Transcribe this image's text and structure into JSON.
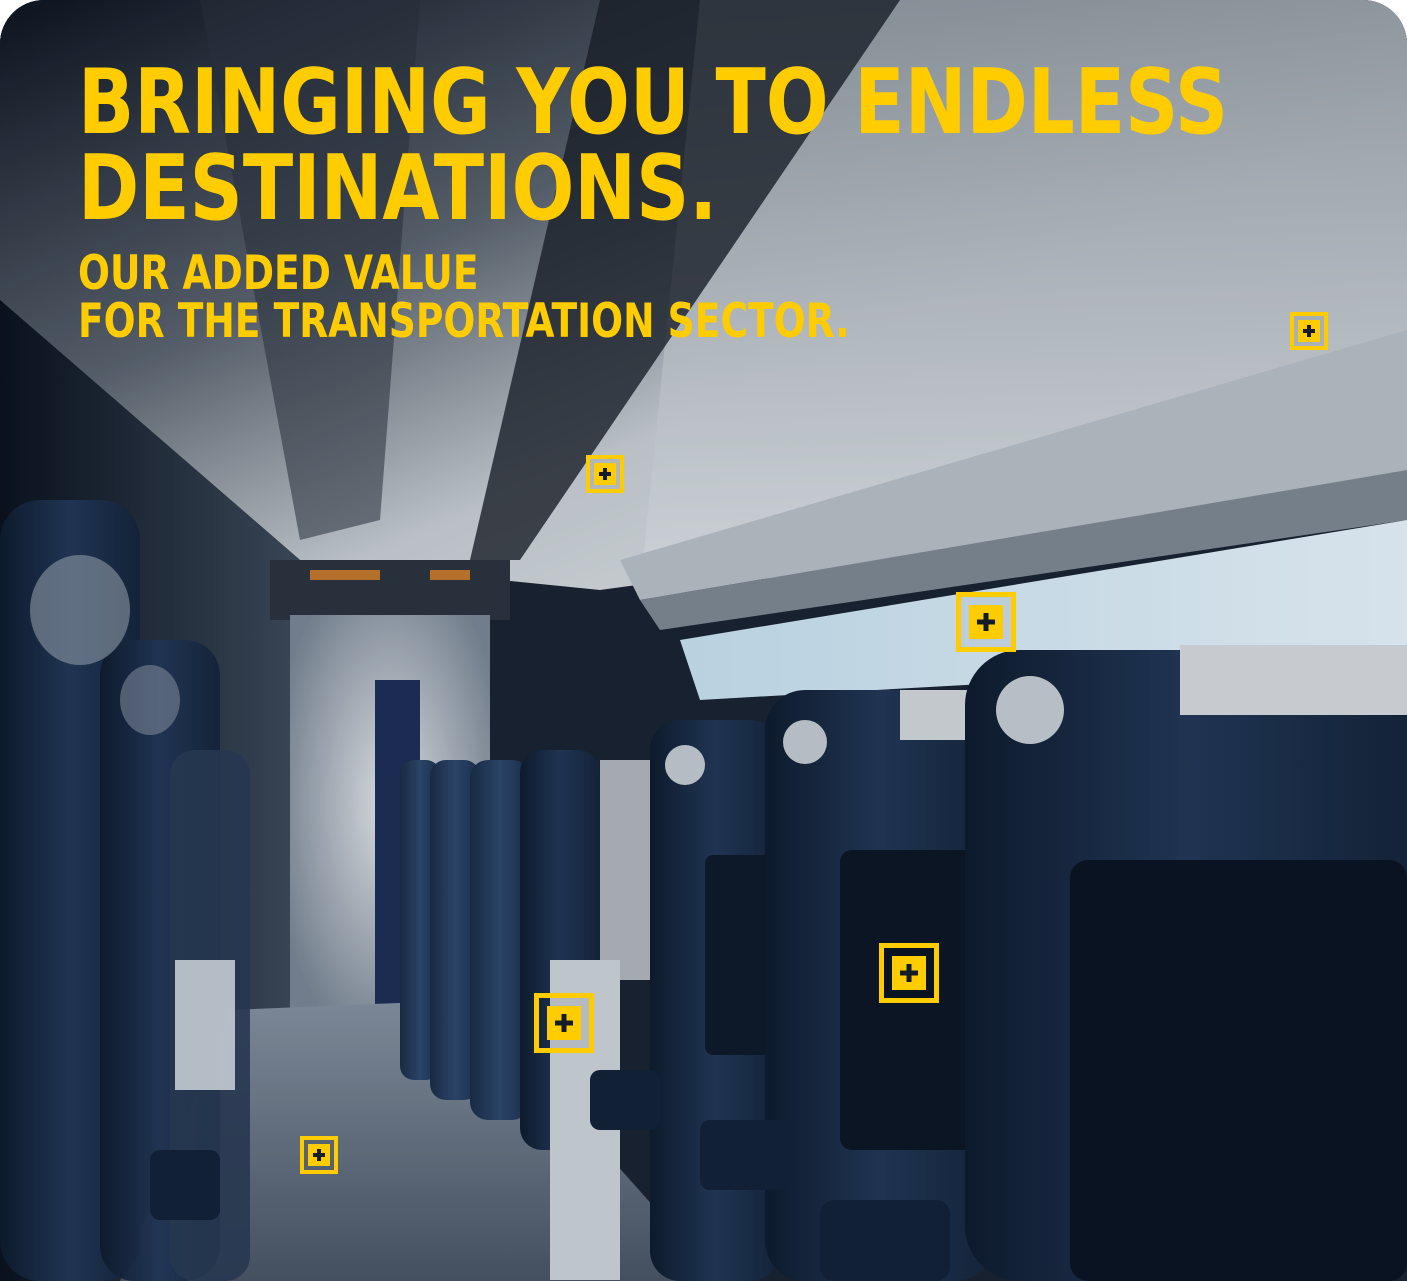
{
  "headline": {
    "title_line_1": "BRINGING YOU TO ENDLESS",
    "title_line_2": "DESTINATIONS.",
    "subtitle_line_1": "OUR ADDED VALUE",
    "subtitle_line_2": "FOR THE TRANSPORTATION SECTOR."
  },
  "colors": {
    "accent": "#ffcc00",
    "hotspot_plus": "#141c28",
    "scene_seat": "#1f3552",
    "scene_ceiling": "#dfe5ea"
  },
  "hotspots": [
    {
      "name": "hotspot-top-right",
      "icon": "plus-icon"
    },
    {
      "name": "hotspot-ceiling-center",
      "icon": "plus-icon"
    },
    {
      "name": "hotspot-luggage-rack",
      "icon": "plus-icon"
    },
    {
      "name": "hotspot-seat-back",
      "icon": "plus-icon"
    },
    {
      "name": "hotspot-armrest",
      "icon": "plus-icon"
    },
    {
      "name": "hotspot-aisle-floor",
      "icon": "plus-icon"
    }
  ]
}
